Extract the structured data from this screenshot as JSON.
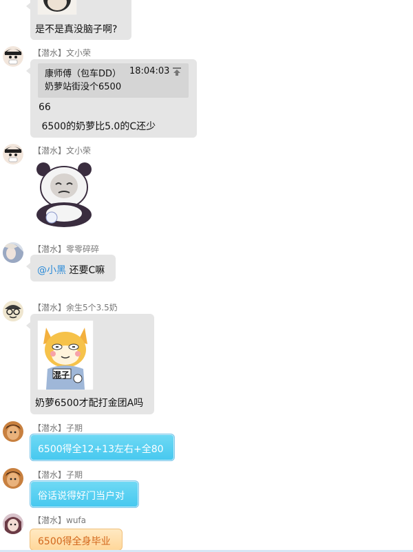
{
  "messages": [
    {
      "text": "是不是真没脑子啊?"
    },
    {
      "sender": "【潜水】文小荣",
      "quote": {
        "author": "康师傅（包车DD）",
        "time": "18:04:03",
        "text": "奶萝站街没个6500"
      },
      "lines": [
        "66",
        " 6500的奶萝比5.0的C还少"
      ]
    },
    {
      "sender": "【潜水】文小荣"
    },
    {
      "sender": "【潜水】零零碎碎",
      "mention": "@小黑",
      "text": " 还要C嘛"
    },
    {
      "sender": "【潜水】余生5个3.5奶",
      "sticker_label": "混子",
      "text": "奶萝6500才配打金团A吗"
    },
    {
      "sender": "【潜水】子期",
      "text": "6500得全12+13左右+全80"
    },
    {
      "sender": "【潜水】子期",
      "text": "俗话说得好门当户对"
    },
    {
      "sender": "【潜水】wufa",
      "text": "6500得全身毕业"
    }
  ],
  "colors": {
    "gray_bubble": "#e5e5e5",
    "blue_bubble": "#46c8ef",
    "yellow_text": "#d2661a",
    "mention": "#2a8ad8"
  }
}
